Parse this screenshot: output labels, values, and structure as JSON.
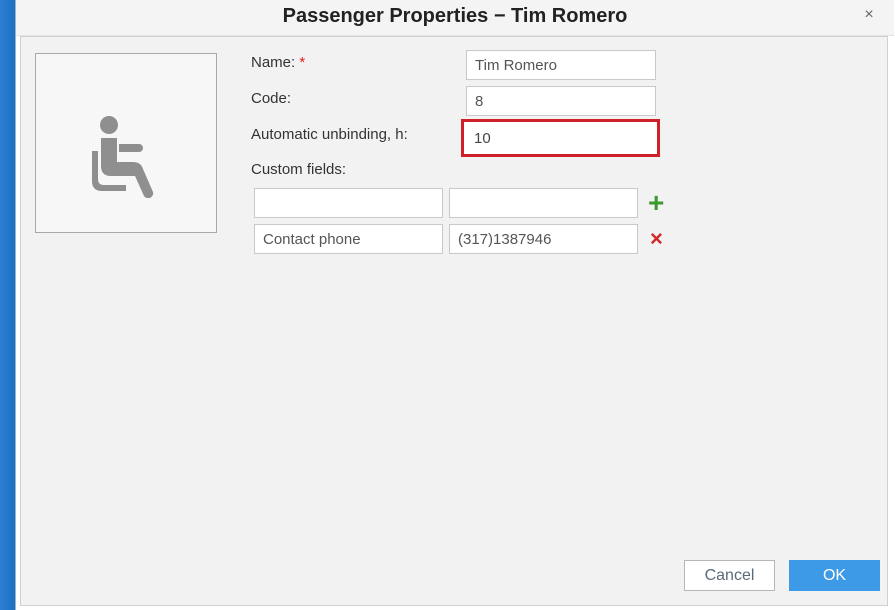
{
  "dialog": {
    "title": "Passenger Properties − Tim Romero",
    "close_label": "×"
  },
  "form": {
    "name_label": "Name:",
    "required_mark": "*",
    "name_value": "Tim Romero",
    "code_label": "Code:",
    "code_value": "8",
    "unbinding_label": "Automatic unbinding, h:",
    "unbinding_value": "10",
    "custom_fields_label": "Custom fields:",
    "custom_fields": [
      {
        "key": "",
        "value": ""
      },
      {
        "key": "Contact phone",
        "value": "(317)1387946"
      }
    ]
  },
  "icons": {
    "add": "plus-icon",
    "remove": "x-icon",
    "avatar": "seated-person-icon"
  },
  "colors": {
    "add_icon": "#3a9a2e",
    "remove_icon": "#d02828",
    "highlight": "#d0202a",
    "ok_button": "#3d9ae6"
  },
  "buttons": {
    "cancel": "Cancel",
    "ok": "OK"
  }
}
